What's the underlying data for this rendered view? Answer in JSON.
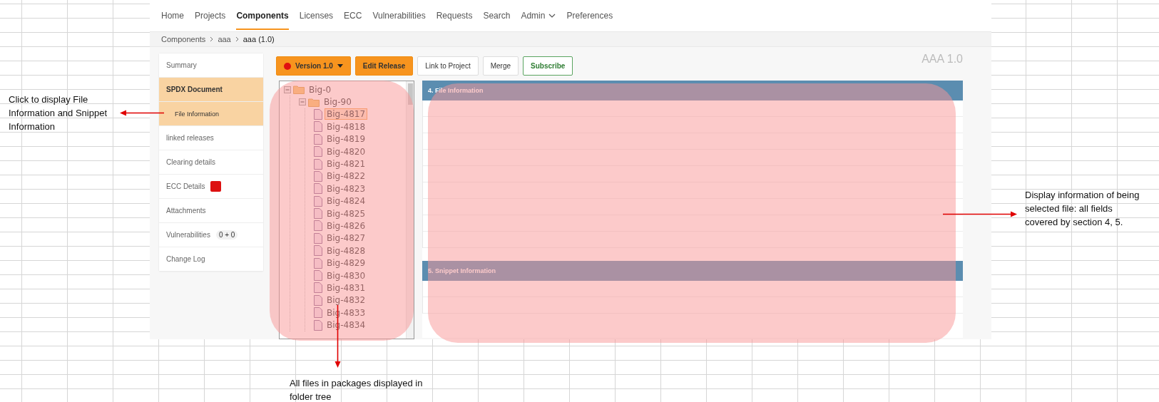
{
  "nav": [
    {
      "label": "Home",
      "selected": false,
      "kind": "link"
    },
    {
      "label": "Projects",
      "selected": false,
      "kind": "link"
    },
    {
      "label": "Components",
      "selected": true,
      "kind": "link"
    },
    {
      "label": "Licenses",
      "selected": false,
      "kind": "link"
    },
    {
      "label": "ECC",
      "selected": false,
      "kind": "link"
    },
    {
      "label": "Vulnerabilities",
      "selected": false,
      "kind": "link"
    },
    {
      "label": "Requests",
      "selected": false,
      "kind": "link"
    },
    {
      "label": "Search",
      "selected": false,
      "kind": "link"
    },
    {
      "label": "Admin",
      "selected": false,
      "kind": "menu"
    },
    {
      "label": "Preferences",
      "selected": false,
      "kind": "link"
    }
  ],
  "breadcrumb": [
    "Components",
    "aaa",
    "aaa (1.0)"
  ],
  "sidebar": [
    {
      "label": "Summary",
      "selected": false
    },
    {
      "label": "SPDX Document",
      "selected": true,
      "children": [
        {
          "label": "File Information",
          "selected": true
        }
      ]
    },
    {
      "label": "linked releases",
      "selected": false
    },
    {
      "label": "Clearing details",
      "selected": false
    },
    {
      "label": "ECC Details",
      "selected": false,
      "color": "#dd1111"
    },
    {
      "label": "Attachments",
      "selected": false
    },
    {
      "label": "Vulnerabilities",
      "selected": false,
      "badge": "0 + 0"
    },
    {
      "label": "Change Log",
      "selected": false
    }
  ],
  "buttons": [
    {
      "label": "Version 1.0",
      "kind": "version"
    },
    {
      "label": "Edit Release",
      "kind": "primary"
    },
    {
      "label": "Link to Project",
      "kind": "default"
    },
    {
      "label": "Merge",
      "kind": "default"
    },
    {
      "label": "Subscribe",
      "kind": "success"
    }
  ],
  "title": "AAA 1.0",
  "tree": [
    {
      "label": "Big-0",
      "kind": "folder",
      "expanded": true,
      "selected": false,
      "children": [
        {
          "label": "Big-90",
          "kind": "folder",
          "expanded": true,
          "selected": false,
          "children": [
            {
              "label": "Big-4817",
              "kind": "file",
              "selected": true
            },
            {
              "label": "Big-4818",
              "kind": "file",
              "selected": false
            },
            {
              "label": "Big-4819",
              "kind": "file",
              "selected": false
            },
            {
              "label": "Big-4820",
              "kind": "file",
              "selected": false
            },
            {
              "label": "Big-4821",
              "kind": "file",
              "selected": false
            },
            {
              "label": "Big-4822",
              "kind": "file",
              "selected": false
            },
            {
              "label": "Big-4823",
              "kind": "file",
              "selected": false
            },
            {
              "label": "Big-4824",
              "kind": "file",
              "selected": false
            },
            {
              "label": "Big-4825",
              "kind": "file",
              "selected": false
            },
            {
              "label": "Big-4826",
              "kind": "file",
              "selected": false
            },
            {
              "label": "Big-4827",
              "kind": "file",
              "selected": false
            },
            {
              "label": "Big-4828",
              "kind": "file",
              "selected": false
            },
            {
              "label": "Big-4829",
              "kind": "file",
              "selected": false
            },
            {
              "label": "Big-4830",
              "kind": "file",
              "selected": false
            },
            {
              "label": "Big-4831",
              "kind": "file",
              "selected": false
            },
            {
              "label": "Big-4832",
              "kind": "file",
              "selected": false
            },
            {
              "label": "Big-4833",
              "kind": "file",
              "selected": false
            },
            {
              "label": "Big-4834",
              "kind": "file",
              "selected": false
            }
          ]
        }
      ]
    }
  ],
  "sections": [
    {
      "title": "4. File Information"
    },
    {
      "title": "5. Snippet Information"
    }
  ],
  "annotations": {
    "left": "Click to display File Information and Snippet Information",
    "right": "Display information of being selected file: all fields covered by section 4, 5.",
    "bottom": "All files in packages displayed in folder tree"
  }
}
